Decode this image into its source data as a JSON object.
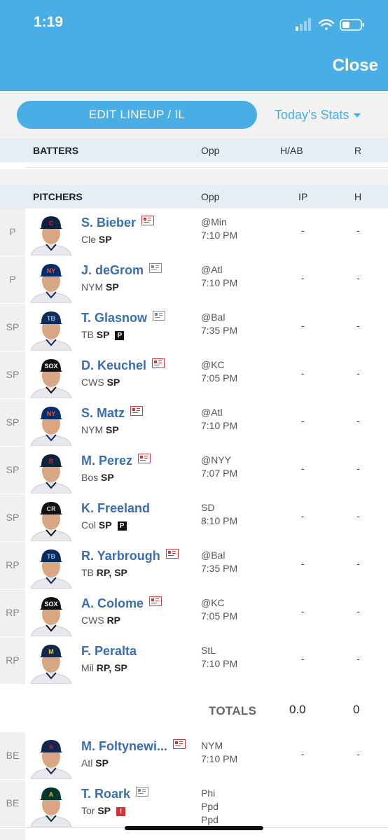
{
  "status": {
    "time": "1:19"
  },
  "header": {
    "close": "Close"
  },
  "toolbar": {
    "edit_label": "EDIT LINEUP / IL",
    "stats_label": "Today's Stats"
  },
  "batters_header": {
    "label": "BATTERS",
    "col1": "Opp",
    "col2": "H/AB",
    "col3": "R"
  },
  "pitchers_header": {
    "label": "PITCHERS",
    "col1": "Opp",
    "col2": "IP",
    "col3": "H"
  },
  "pitchers": [
    {
      "pos": "P",
      "name": "S. Bieber",
      "team": "Cle",
      "roles": "SP",
      "news": "red",
      "opp": "@Min",
      "time": "7:10 PM",
      "ip": "-",
      "h": "-",
      "cap": "#0c2340",
      "logo": "C",
      "logo_color": "#e31937"
    },
    {
      "pos": "P",
      "name": "J. deGrom",
      "team": "NYM",
      "roles": "SP",
      "news": "gray",
      "opp": "@Atl",
      "time": "7:10 PM",
      "ip": "-",
      "h": "-",
      "cap": "#002d72",
      "logo": "NY",
      "logo_color": "#ff5910"
    },
    {
      "pos": "SP",
      "name": "T. Glasnow",
      "team": "TB",
      "roles": "SP",
      "news": "gray",
      "badge": "P",
      "opp": "@Bal",
      "time": "7:35 PM",
      "ip": "-",
      "h": "-",
      "cap": "#092c5c",
      "logo": "TB",
      "logo_color": "#8fbce6"
    },
    {
      "pos": "SP",
      "name": "D. Keuchel",
      "team": "CWS",
      "roles": "SP",
      "news": "red",
      "opp": "@KC",
      "time": "7:05 PM",
      "ip": "-",
      "h": "-",
      "cap": "#111111",
      "logo": "SOX",
      "logo_color": "#ffffff"
    },
    {
      "pos": "SP",
      "name": "S. Matz",
      "team": "NYM",
      "roles": "SP",
      "news": "red",
      "opp": "@Atl",
      "time": "7:10 PM",
      "ip": "-",
      "h": "-",
      "cap": "#002d72",
      "logo": "NY",
      "logo_color": "#ff5910"
    },
    {
      "pos": "SP",
      "name": "M. Perez",
      "team": "Bos",
      "roles": "SP",
      "news": "red",
      "opp": "@NYY",
      "time": "7:07 PM",
      "ip": "-",
      "h": "-",
      "cap": "#0c2340",
      "logo": "B",
      "logo_color": "#bd3039"
    },
    {
      "pos": "SP",
      "name": "K. Freeland",
      "team": "Col",
      "roles": "SP",
      "news": "none",
      "badge": "P",
      "opp": "SD",
      "time": "8:10 PM",
      "ip": "-",
      "h": "-",
      "cap": "#111111",
      "logo": "CR",
      "logo_color": "#c4ced4"
    },
    {
      "pos": "RP",
      "name": "R. Yarbrough",
      "team": "TB",
      "roles": "RP, SP",
      "news": "red",
      "opp": "@Bal",
      "time": "7:35 PM",
      "ip": "-",
      "h": "-",
      "cap": "#092c5c",
      "logo": "TB",
      "logo_color": "#8fbce6"
    },
    {
      "pos": "RP",
      "name": "A. Colome",
      "team": "CWS",
      "roles": "RP",
      "news": "red",
      "opp": "@KC",
      "time": "7:05 PM",
      "ip": "-",
      "h": "-",
      "cap": "#111111",
      "logo": "SOX",
      "logo_color": "#ffffff"
    },
    {
      "pos": "RP",
      "name": "F. Peralta",
      "team": "Mil",
      "roles": "RP, SP",
      "news": "none",
      "opp": "StL",
      "time": "7:10 PM",
      "ip": "-",
      "h": "-",
      "cap": "#12284b",
      "logo": "M",
      "logo_color": "#ffc52f"
    }
  ],
  "totals": {
    "label": "TOTALS",
    "ip": "0.0",
    "h": "0"
  },
  "bench": [
    {
      "pos": "BE",
      "name": "M. Foltynewi...",
      "team": "Atl",
      "roles": "SP",
      "news": "red",
      "opp": "NYM",
      "time": "7:10 PM",
      "ip": "-",
      "h": "-",
      "cap": "#13274f",
      "logo": "A",
      "logo_color": "#ce1141"
    },
    {
      "pos": "BE",
      "name": "T. Roark",
      "team": "Tor",
      "roles": "SP",
      "news": "gray",
      "badge": "!",
      "opp": "Phi",
      "time": "Ppd",
      "time2": "Ppd",
      "ip": "",
      "h": "",
      "cap": "#003831",
      "logo": "A",
      "logo_color": "#efb21e"
    }
  ]
}
